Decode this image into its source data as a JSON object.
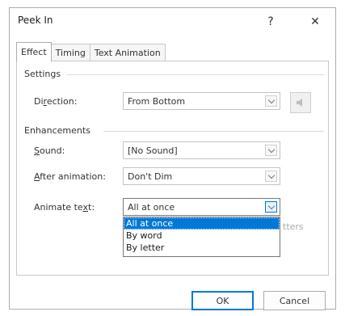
{
  "dialog": {
    "title": "Peek In",
    "help_glyph": "?",
    "close_glyph": "✕"
  },
  "tabs": [
    {
      "label": "Effect",
      "active": true
    },
    {
      "label": "Timing",
      "active": false
    },
    {
      "label": "Text Animation",
      "active": false
    }
  ],
  "settings": {
    "group_label": "Settings",
    "direction": {
      "label_pre": "Di",
      "label_u": "r",
      "label_post": "ection:",
      "value": "From Bottom"
    }
  },
  "enhancements": {
    "group_label": "Enhancements",
    "sound": {
      "label_u": "S",
      "label_post": "ound:",
      "value": "[No Sound]",
      "icon": "speaker-icon"
    },
    "after_animation": {
      "label_u": "A",
      "label_post": "fter animation:",
      "value": "Don't Dim"
    },
    "animate_text": {
      "label_pre": "Animate te",
      "label_u": "x",
      "label_post": "t:",
      "value": "All at once"
    },
    "animate_text_options": [
      "All at once",
      "By word",
      "By letter"
    ],
    "hidden_suffix": "tters"
  },
  "buttons": {
    "ok": "OK",
    "cancel": "Cancel"
  },
  "colors": {
    "selection": "#0078d7",
    "border": "#adadad"
  }
}
